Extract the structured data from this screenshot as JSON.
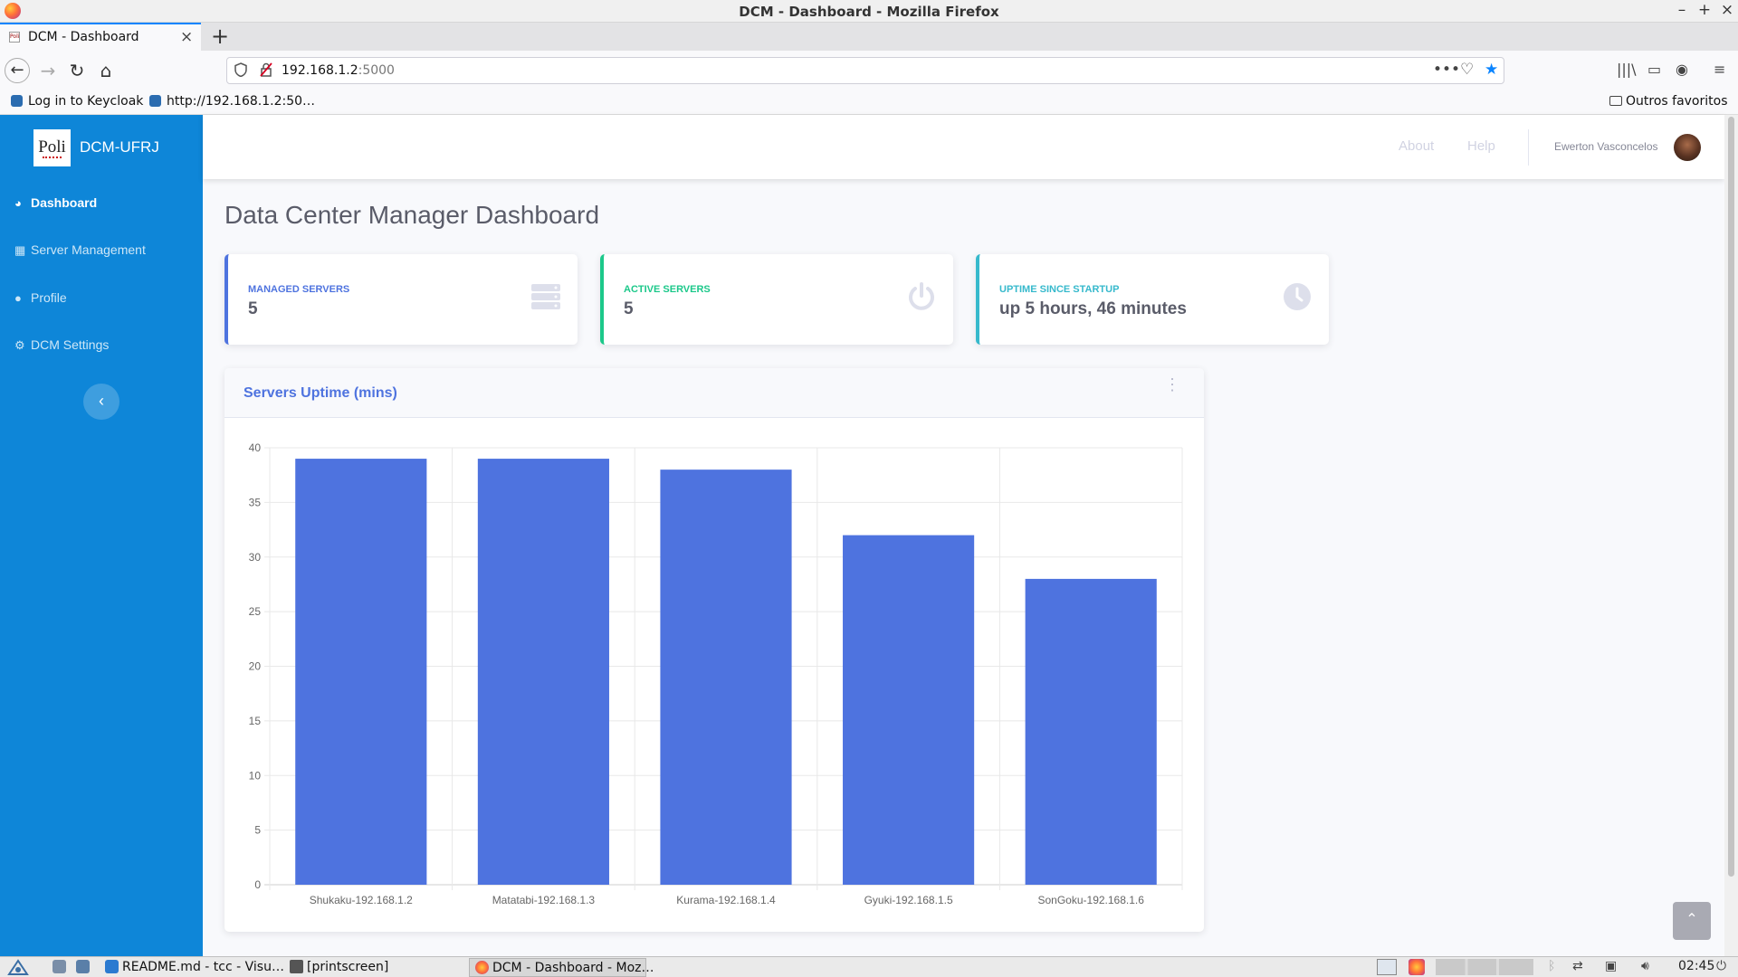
{
  "browser": {
    "window_title": "DCM - Dashboard - Mozilla Firefox",
    "controls": {
      "minimize": "–",
      "maximize": "+",
      "close": "×"
    },
    "tab": {
      "favicon": "Poli",
      "title": "DCM - Dashboard",
      "close": "×"
    },
    "new_tab": "+",
    "nav": {
      "back": "←",
      "forward": "→",
      "reload": "↻",
      "home": "⌂"
    },
    "url": {
      "host": "192.168.1.2",
      "port": ":5000",
      "shield_icon": "shield-icon",
      "insecure_icon": "insecure-lock-icon"
    },
    "url_actions": {
      "more": "•••",
      "pocket": "♡",
      "bookmark_star": "★"
    },
    "toolbar_right": {
      "library": "|||\\",
      "sidebar": "▭",
      "account": "◉",
      "menu": "≡"
    },
    "bookmarks": [
      {
        "label": "Log in to Keycloak"
      },
      {
        "label": "http://192.168.1.2:50…"
      }
    ],
    "other_bookmarks": "Outros favoritos"
  },
  "app": {
    "brand": {
      "logo_text": "Poli",
      "name": "DCM-UFRJ"
    },
    "sidebar": {
      "items": [
        {
          "label": "Dashboard",
          "icon": "tachometer-icon",
          "glyph": "◕",
          "active": true
        },
        {
          "label": "Server Management",
          "icon": "table-icon",
          "glyph": "▦",
          "active": false
        },
        {
          "label": "Profile",
          "icon": "user-icon",
          "glyph": "●",
          "active": false
        },
        {
          "label": "DCM Settings",
          "icon": "cogs-icon",
          "glyph": "⚙",
          "active": false
        }
      ],
      "toggle": "‹"
    },
    "topbar": {
      "links": [
        {
          "label": "About"
        },
        {
          "label": "Help"
        }
      ],
      "user_name": "Ewerton Vasconcelos"
    },
    "page_title": "Data Center Manager Dashboard",
    "cards": [
      {
        "label": "Managed Servers",
        "value": "5",
        "color": "#4e73df",
        "icon": "server-icon"
      },
      {
        "label": "Active Servers",
        "value": "5",
        "color": "#1cc88a",
        "icon": "power-icon"
      },
      {
        "label": "Uptime since startup",
        "value": "up 5 hours, 46 minutes",
        "color": "#36b9cc",
        "icon": "clock-icon"
      }
    ],
    "chart_card": {
      "title": "Servers Uptime (mins)",
      "menu": "⋮"
    },
    "scroll_top": "⌃"
  },
  "chart_data": {
    "type": "bar",
    "title": "Servers Uptime (mins)",
    "categories": [
      "Shukaku-192.168.1.2",
      "Matatabi-192.168.1.3",
      "Kurama-192.168.1.4",
      "Gyuki-192.168.1.5",
      "SonGoku-192.168.1.6"
    ],
    "values": [
      39,
      39,
      38,
      32,
      28
    ],
    "ylim": [
      0,
      40
    ],
    "yticks": [
      0,
      5,
      10,
      15,
      20,
      25,
      30,
      35,
      40
    ],
    "bar_color": "#4e73df",
    "grid": true
  },
  "taskbar": {
    "items": [
      {
        "label": "README.md - tcc - Visu…",
        "icon": "vscode-icon"
      },
      {
        "label": "[printscreen]",
        "icon": "folder-icon"
      },
      {
        "label": "DCM - Dashboard - Moz…",
        "icon": "firefox-icon"
      }
    ],
    "clock": "02:45"
  }
}
